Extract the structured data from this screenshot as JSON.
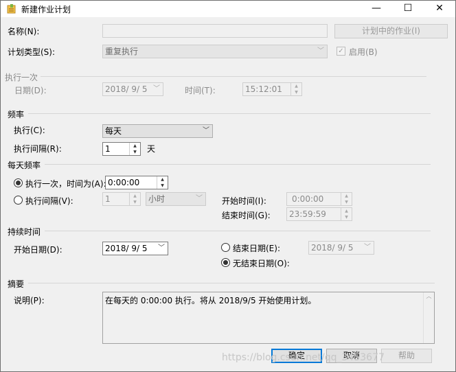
{
  "window": {
    "title": "新建作业计划",
    "minimize": "—",
    "maximize": "☐",
    "close": "✕"
  },
  "name": {
    "label": "名称(N):",
    "value": ""
  },
  "jobs_in_schedule_button": "计划中的作业(I)",
  "schedule_type": {
    "label": "计划类型(S):",
    "value": "重复执行"
  },
  "enabled": {
    "label": "启用(B)",
    "checked": true
  },
  "one_time": {
    "heading": "执行一次",
    "date_label": "日期(D):",
    "date_value": "2018/ 9/ 5",
    "time_label": "时间(T):",
    "time_value": "15:12:01"
  },
  "frequency": {
    "heading": "频率",
    "occurs_label": "执行(C):",
    "occurs_value": "每天",
    "recurs_label": "执行间隔(R):",
    "recurs_value": "1",
    "recurs_unit": "天"
  },
  "daily_frequency": {
    "heading": "每天频率",
    "once_label": "执行一次，时间为(A):",
    "once_value": "0:00:00",
    "once_selected": true,
    "every_label": "执行间隔(V):",
    "every_value": "1",
    "every_unit": "小时",
    "start_label": "开始时间(I):",
    "start_value": "0:00:00",
    "end_label": "结束时间(G):",
    "end_value": "23:59:59"
  },
  "duration": {
    "heading": "持续时间",
    "start_date_label": "开始日期(D):",
    "start_date_value": "2018/ 9/ 5",
    "end_date_label": "结束日期(E):",
    "end_date_value": "2018/ 9/ 5",
    "no_end_label": "无结束日期(O):",
    "no_end_selected": true
  },
  "summary": {
    "heading": "摘要",
    "description_label": "说明(P):",
    "description_value": "在每天的 0:00:00 执行。将从 2018/9/5 开始使用计划。"
  },
  "buttons": {
    "ok": "确定",
    "cancel": "取消",
    "help": "帮助"
  },
  "watermark": "https://blog.csdn.net/qq_3453677"
}
